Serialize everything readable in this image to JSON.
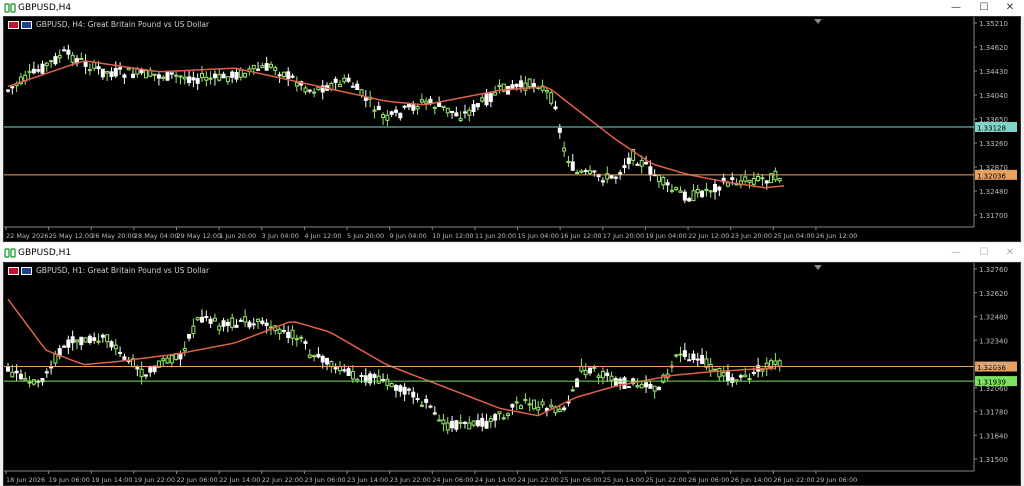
{
  "windows": [
    {
      "title": "GBPUSD,H4",
      "symbol": "GBPUSD",
      "period": "H4",
      "description": "Great Britain Pound vs US Dollar",
      "price_labels": [
        "1.35210",
        "1.34620",
        "1.34430",
        "1.34040",
        "1.33650",
        "1.33260",
        "1.32870",
        "1.32480",
        "1.31700"
      ],
      "hline_labels": [
        {
          "text": "1.33128",
          "color": "#7fd6c8"
        },
        {
          "text": "1.32036",
          "color": "#e8a060"
        }
      ],
      "time_labels": [
        "22 May 2026",
        "25 May 12:00",
        "26 May 20:00",
        "28 May 04:00",
        "29 May 12:00",
        "1 Jun 20:00",
        "3 Jun 04:00",
        "4 Jun 12:00",
        "5 Jun 20:00",
        "9 Jun 04:00",
        "10 Jun 12:00",
        "11 Jun 20:00",
        "15 Jun 04:00",
        "16 Jun 12:00",
        "17 Jun 20:00",
        "19 Jun 04:00",
        "22 Jun 12:00",
        "23 Jun 20:00",
        "25 Jun 04:00",
        "26 Jun 12:00"
      ]
    },
    {
      "title": "GBPUSD,H1",
      "symbol": "GBPUSD",
      "period": "H1",
      "description": "Great Britain Pound vs US Dollar",
      "price_labels": [
        "1.32760",
        "1.32620",
        "1.32480",
        "1.32340",
        "1.32200",
        "1.32060",
        "1.31780",
        "1.31640",
        "1.31500"
      ],
      "hline_labels": [
        {
          "text": "1.32036",
          "color": "#e8a060"
        },
        {
          "text": "1.31939",
          "color": "#7ce060"
        }
      ],
      "time_labels": [
        "18 Jun 2026",
        "19 Jun 06:00",
        "19 Jun 14:00",
        "19 Jun 22:00",
        "22 Jun 06:00",
        "22 Jun 14:00",
        "22 Jun 22:00",
        "23 Jun 06:00",
        "23 Jun 14:00",
        "23 Jun 22:00",
        "24 Jun 06:00",
        "24 Jun 14:00",
        "24 Jun 22:00",
        "25 Jun 06:00",
        "25 Jun 14:00",
        "25 Jun 22:00",
        "26 Jun 06:00",
        "26 Jun 14:00",
        "26 Jun 22:00",
        "29 Jun 06:00"
      ]
    }
  ],
  "controls": {
    "minimize": "—",
    "maximize": "☐",
    "close": "✕"
  },
  "colors": {
    "bull": "#9ae66e",
    "bear": "#ffffff",
    "ma": "#e0604a",
    "bg": "#000000"
  }
}
